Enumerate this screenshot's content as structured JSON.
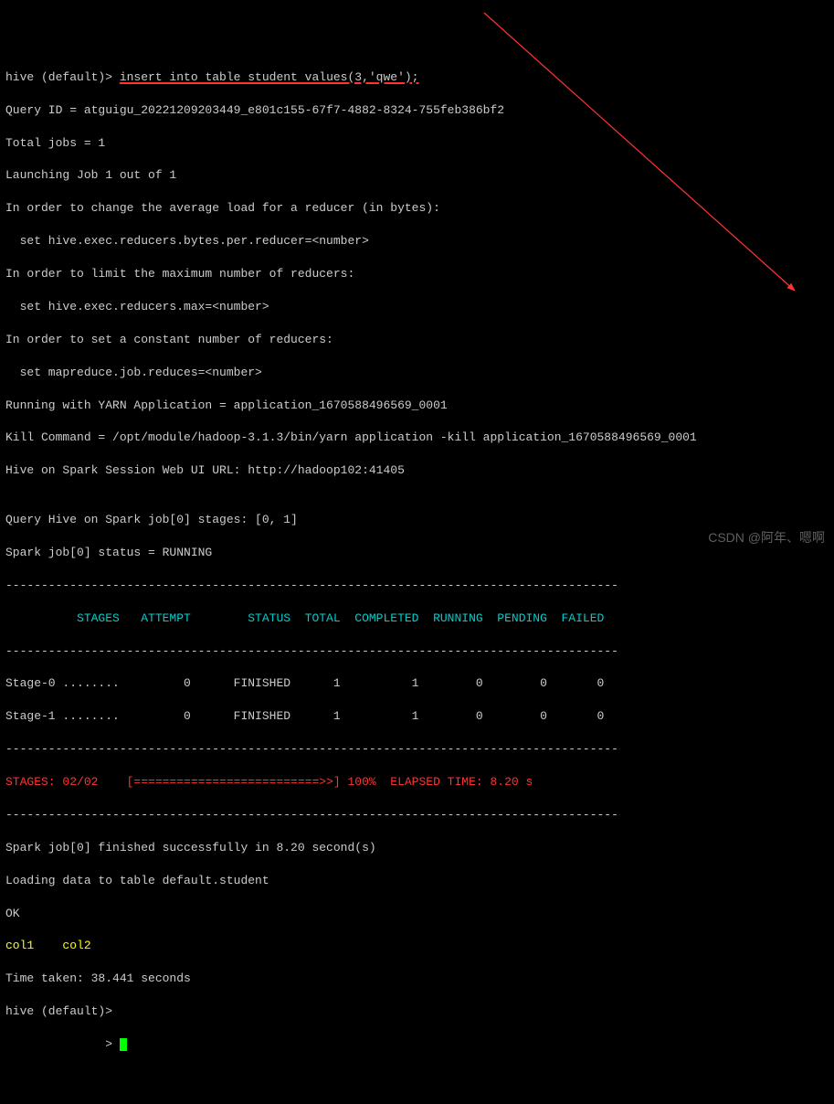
{
  "prompt1": "hive (default)> ",
  "command": "insert into table student values(3,'qwe');",
  "lines": [
    "Query ID = atguigu_20221209203449_e801c155-67f7-4882-8324-755feb386bf2",
    "Total jobs = 1",
    "Launching Job 1 out of 1",
    "In order to change the average load for a reducer (in bytes):",
    "  set hive.exec.reducers.bytes.per.reducer=<number>",
    "In order to limit the maximum number of reducers:",
    "  set hive.exec.reducers.max=<number>",
    "In order to set a constant number of reducers:",
    "  set mapreduce.job.reduces=<number>",
    "Running with YARN Application = application_1670588496569_0001",
    "Kill Command = /opt/module/hadoop-3.1.3/bin/yarn application -kill application_1670588496569_0001",
    "Hive on Spark Session Web UI URL: http://hadoop102:41405",
    "",
    "Query Hive on Spark job[0] stages: [0, 1]",
    "Spark job[0] status = RUNNING"
  ],
  "dashline": "--------------------------------------------------------------------------------------",
  "header": "          STAGES   ATTEMPT        STATUS  TOTAL  COMPLETED  RUNNING  PENDING  FAILED",
  "row_stage0": "Stage-0 ........         0      FINISHED      1          1        0        0       0",
  "row_stage1": "Stage-1 ........         0      FINISHED      1          1        0        0       0",
  "stages_label": "STAGES: 02/02    ",
  "progress_bar": "[==========================>>] 100%  ELAPSED TIME: 8.20 s",
  "post_lines": [
    "Spark job[0] finished successfully in 8.20 second(s)",
    "Loading data to table default.student",
    "OK"
  ],
  "col_header": "col1    col2",
  "time_taken": "Time taken: 38.441 seconds",
  "prompt2": "hive (default)>",
  "prompt3": "              > ",
  "watermark": "CSDN @阿年、嗯啊",
  "chart_data": {
    "type": "table",
    "title": "Spark Stages",
    "columns": [
      "STAGES",
      "ATTEMPT",
      "STATUS",
      "TOTAL",
      "COMPLETED",
      "RUNNING",
      "PENDING",
      "FAILED"
    ],
    "rows": [
      {
        "STAGES": "Stage-0",
        "ATTEMPT": 0,
        "STATUS": "FINISHED",
        "TOTAL": 1,
        "COMPLETED": 1,
        "RUNNING": 0,
        "PENDING": 0,
        "FAILED": 0
      },
      {
        "STAGES": "Stage-1",
        "ATTEMPT": 0,
        "STATUS": "FINISHED",
        "TOTAL": 1,
        "COMPLETED": 1,
        "RUNNING": 0,
        "PENDING": 0,
        "FAILED": 0
      }
    ],
    "progress_pct": 100,
    "elapsed_time_s": 8.2,
    "total_time_s": 38.441
  }
}
